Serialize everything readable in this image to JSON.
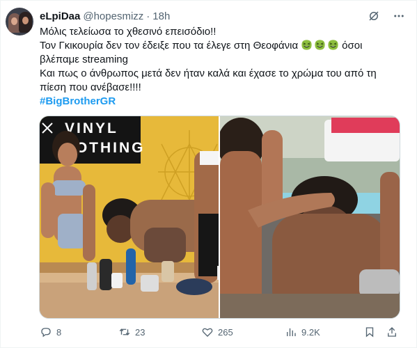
{
  "tweet": {
    "author_name": "eLpiDaa",
    "author_handle": "@hopesmizz",
    "separator": "·",
    "timestamp": "18h",
    "text_lines": [
      "Μόλις τελείωσα το χθεσινό επεισόδιο!!",
      "Τον Γκικουρία δεν τον έδειξε που τα έλεγε στη Θεοφάνια",
      "όσοι",
      "βλέπαμε streaming",
      "Και πως ο άνθρωπος μετά δεν ήταν καλά και έχασε το χρώμα του από τη",
      "πίεση που ανέβασε!!!!"
    ],
    "hashtag": "#BigBrotherGR",
    "photos": [
      {
        "sign_text_1": "VINYL",
        "sign_text_2": "LOTHING"
      },
      {}
    ],
    "actions": {
      "replies": "8",
      "retweets": "23",
      "likes": "265",
      "views": "9.2K"
    }
  },
  "icons": {
    "mute": "no-grok-slash-icon",
    "more": "more-dots-icon",
    "reply": "reply-icon",
    "retweet": "retweet-icon",
    "like": "heart-icon",
    "views": "views-chart-icon",
    "bookmark": "bookmark-icon",
    "share": "share-icon",
    "emoji": "laughing-face-emoji"
  },
  "colors": {
    "accent": "#1d9bf0",
    "secondary_text": "#536471",
    "primary_text": "#0f1419"
  }
}
